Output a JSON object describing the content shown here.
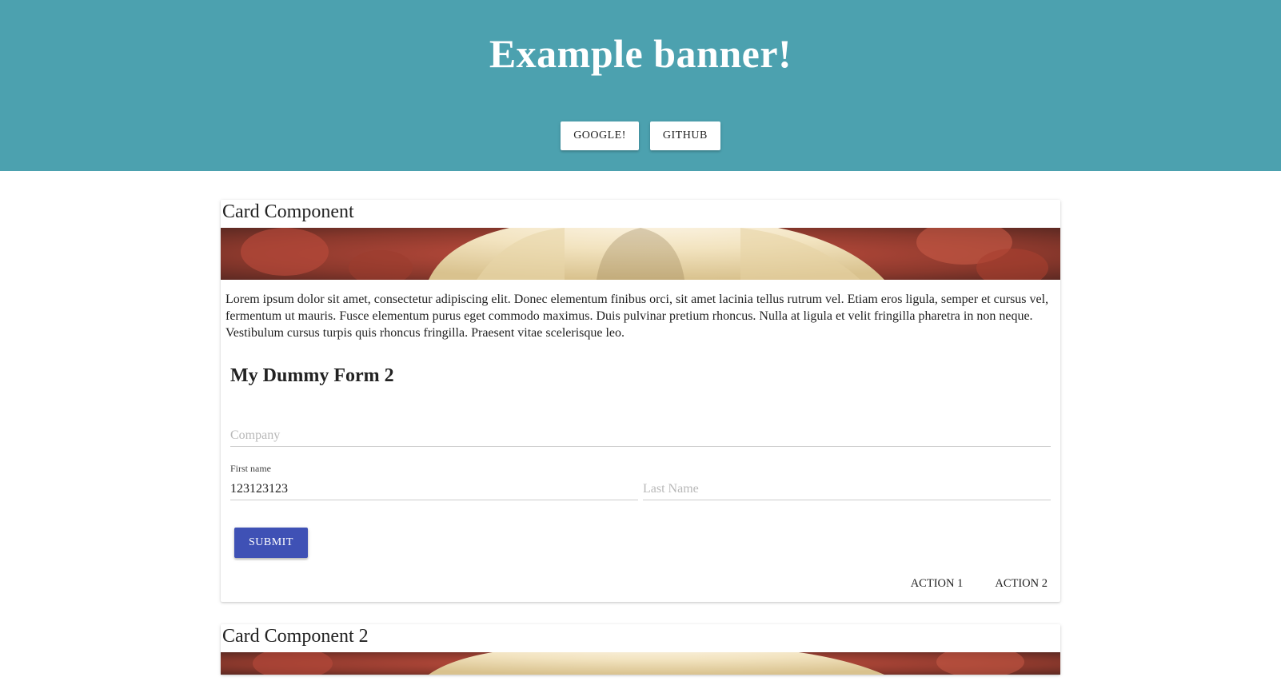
{
  "banner": {
    "title": "Example banner!",
    "buttons": {
      "google": "GOOGLE!",
      "github": "GITHUB"
    }
  },
  "card1": {
    "title": "Card Component",
    "body": "Lorem ipsum dolor sit amet, consectetur adipiscing elit. Donec elementum finibus orci, sit amet lacinia tellus rutrum vel. Etiam eros ligula, semper et cursus vel, fermentum ut mauris. Fusce elementum purus eget commodo maximus. Duis pulvinar pretium rhoncus. Nulla at ligula et velit fringilla pharetra in non neque. Vestibulum cursus turpis quis rhoncus fringilla. Praesent vitae scelerisque leo.",
    "form": {
      "title": "My Dummy Form 2",
      "company": {
        "placeholder": "Company",
        "value": ""
      },
      "first_name": {
        "label": "First name",
        "value": "123123123"
      },
      "last_name": {
        "placeholder": "Last Name",
        "value": ""
      },
      "submit_label": "SUBMIT"
    },
    "actions": {
      "a1": "ACTION 1",
      "a2": "ACTION 2"
    }
  },
  "card2": {
    "title": "Card Component 2"
  }
}
